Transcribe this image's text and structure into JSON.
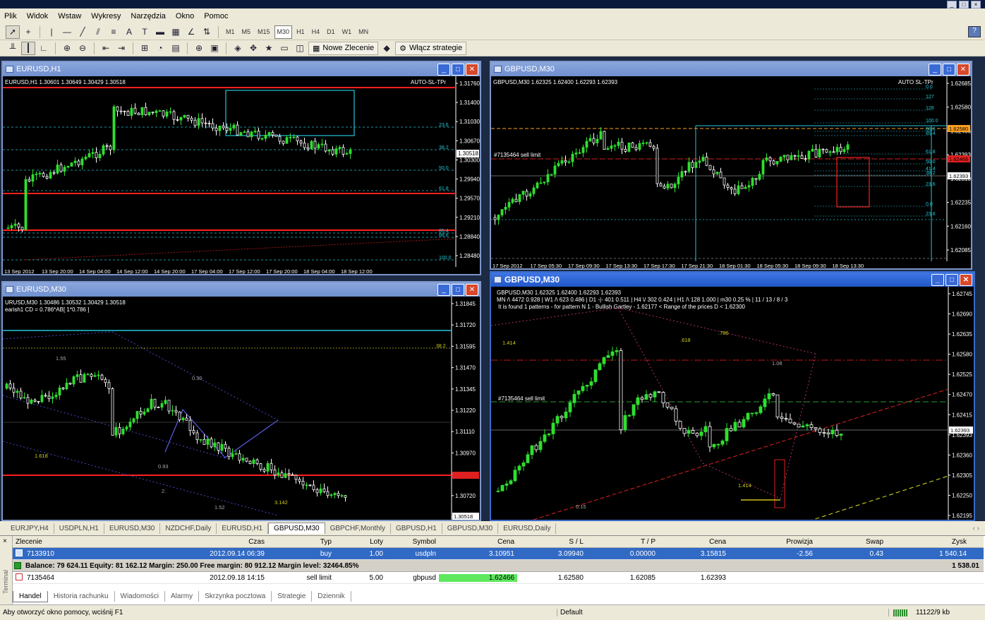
{
  "menu": [
    "Plik",
    "Widok",
    "Wstaw",
    "Wykresy",
    "Narzędzia",
    "Okno",
    "Pomoc"
  ],
  "timeframes": [
    "M1",
    "M5",
    "M15",
    "M30",
    "H1",
    "H4",
    "D1",
    "W1",
    "MN"
  ],
  "active_timeframe": "M30",
  "toolbar2": {
    "new_order": "Nowe Zlecenie",
    "strategies": "Włącz strategie"
  },
  "windows": {
    "w1": {
      "title": "EURUSD,H1",
      "info": "EURUSD,H1  1.30601 1.30649 1.30429 1.30518",
      "badge": "AUTO-SL-TPr",
      "prices": [
        "1.31760",
        "1.31400",
        "1.31030",
        "1.30670",
        "1.30300",
        "1.29940",
        "1.29570",
        "1.29210",
        "1.28840",
        "1.28480"
      ],
      "current_price": "1.30518",
      "fib": [
        "23.6",
        "38.2",
        "50.0",
        "61.8",
        "85.4",
        "88.6",
        "100.0"
      ],
      "dates": [
        "13 Sep 2012",
        "13 Sep 20:00",
        "14 Sep 04:00",
        "14 Sep 12:00",
        "14 Sep 20:00",
        "17 Sep 04:00",
        "17 Sep 12:00",
        "17 Sep 20:00",
        "18 Sep 04:00",
        "18 Sep 12:00"
      ]
    },
    "w2": {
      "title": "GBPUSD,M30",
      "info": "GBPUSD,M30  1.62325 1.62400 1.62293 1.62393",
      "badge": "AUTO SL-TPr",
      "order": "#7135464 sell limit",
      "prices": [
        "1.62685",
        "1.62580",
        "1.62466",
        "1.62393",
        "1.62310",
        "1.62235",
        "1.62160",
        "1.62085"
      ],
      "fib": [
        "0.0",
        "127",
        "128",
        "100.0",
        "88.6",
        "85.4",
        "61.8",
        "50.0",
        "41.4",
        "38.2",
        "23.6",
        "0.0",
        "23.6"
      ],
      "dates": [
        "17 Sep 2012",
        "17 Sep 05:30",
        "17 Sep 09:30",
        "17 Sep 13:30",
        "17 Sep 17:30",
        "17 Sep 21:30",
        "18 Sep 01:30",
        "18 Sep 05:30",
        "18 Sep 09:30",
        "18 Sep 13:30"
      ]
    },
    "w3": {
      "title": "EURUSD,M30",
      "info": "URUSD,M30  1.30486 1.30532 1.30429 1.30518",
      "info2": "earish1 CD = 0.786*AB[ 1*0.786 ]",
      "prices": [
        "1.31845",
        "1.31720",
        "1.31595",
        "1.31470",
        "1.31345",
        "1.31220",
        "1.31110",
        "1.30970",
        "1.30845",
        "1.30720",
        "1.30595",
        "1.30518"
      ],
      "fib_382": "38.2",
      "labels": [
        "1.55",
        "0.30",
        "1.618",
        "0.93",
        "2.",
        "1.52",
        "3.142"
      ]
    },
    "w4": {
      "title": "GBPUSD,M30",
      "info": "GBPUSD,M30  1.62325 1.62400 1.62293 1.62393",
      "info2": "MN /\\ 4472   0.928  |  W1 /\\ 623   0.486  |  D1 -|- 401   0.511  |  H4 \\/ 302   0.424  |  H1 /\\ 128   1.000  |  m30  0.25 %  |  11 / 13 / 8 / 3",
      "info3": "It is found 1 patterns  -  for pattern N 1 - Bullish Gartley - 1.62177 < Range of the prices D < 1.62300",
      "order": "#7135464 sell limit",
      "prices": [
        "1.62745",
        "1.62690",
        "1.62635",
        "1.62580",
        "1.62525",
        "1.62470",
        "1.62415",
        "1.62393",
        "1.62360",
        "1.62305",
        "1.62250",
        "1.62195"
      ],
      "labels": [
        "1.414",
        ".618",
        ".786",
        "1.08",
        "1.414",
        "0.15"
      ]
    }
  },
  "chart_tabs": [
    "EURJPY,H4",
    "USDPLN,H1",
    "EURUSD,M30",
    "NZDCHF,Daily",
    "EURUSD,H1",
    "GBPUSD,M30",
    "GBPCHF,Monthly",
    "GBPUSD,H1",
    "GBPUSD,M30",
    "EURUSD,Daily"
  ],
  "selected_chart_tab": "GBPUSD,M30",
  "terminal": {
    "side_label": "Terminal",
    "columns": [
      "Zlecenie",
      "Czas",
      "Typ",
      "Loty",
      "Symbol",
      "Cena",
      "S / L",
      "T / P",
      "Cena",
      "Prowizja",
      "Swap",
      "Zysk"
    ],
    "rows": [
      {
        "ticket": "7133910",
        "time": "2012.09.14 06:39",
        "type": "buy",
        "lots": "1.00",
        "symbol": "usdpln",
        "price": "3.10951",
        "sl": "3.09940",
        "tp": "0.00000",
        "cur": "3.15815",
        "commission": "-2.56",
        "swap": "0.43",
        "profit": "1 540.14"
      },
      {
        "ticket": "7135464",
        "time": "2012.09.18 14:15",
        "type": "sell limit",
        "lots": "5.00",
        "symbol": "gbpusd",
        "price": "1.62466",
        "sl": "1.62580",
        "tp": "1.62085",
        "cur": "1.62393",
        "commission": "",
        "swap": "",
        "profit": ""
      }
    ],
    "balance_line": "Balance: 79 624.11  Equity: 81 162.12  Margin: 250.00  Free margin: 80 912.12  Margin level: 32464.85%",
    "balance_total": "1 538.01",
    "tabs": [
      "Handel",
      "Historia rachunku",
      "Wiadomości",
      "Alarmy",
      "Skrzynka pocztowa",
      "Strategie",
      "Dziennik"
    ]
  },
  "status": {
    "help": "Aby otworzyć okno pomocy, wciśnij F1",
    "profile": "Default",
    "traffic": "11122/9 kb"
  },
  "colors": {
    "bull": "#2ee02e",
    "bear": "#ffffff",
    "chart_bg": "#000000",
    "grid": "#2a2a2a",
    "red_line": "#ff2020",
    "cyan": "#23c6d8",
    "accent_title": "#2157c9"
  }
}
